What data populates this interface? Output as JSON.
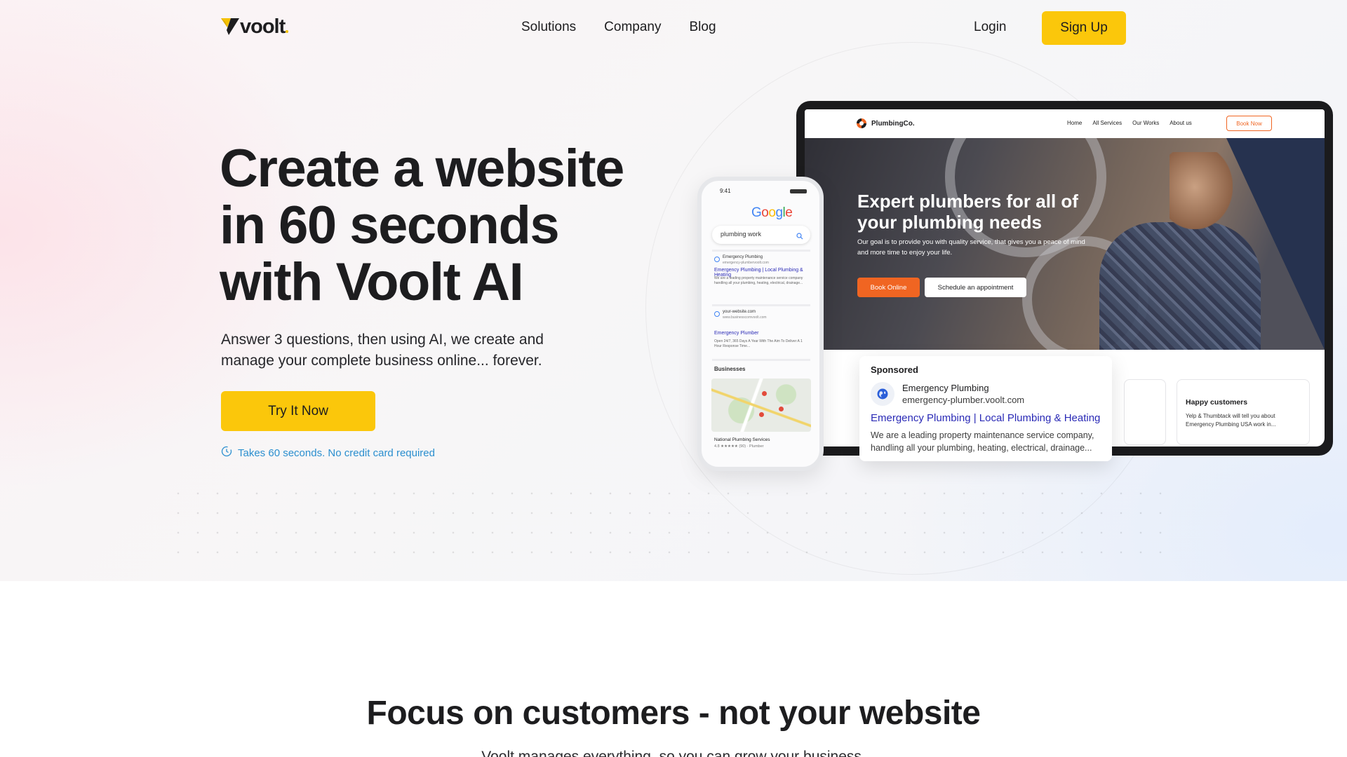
{
  "brand": {
    "name": "voolt",
    "accent": "#fbc70b"
  },
  "nav": {
    "links": [
      "Solutions",
      "Company",
      "Blog"
    ],
    "login": "Login",
    "signup": "Sign Up"
  },
  "hero": {
    "title_lines": [
      "Create a website",
      "in 60 seconds",
      "with Voolt AI"
    ],
    "subtitle": "Answer 3 questions, then using AI, we create and manage your complete business online... forever.",
    "cta": "Try It Now",
    "note": "Takes 60 seconds. No credit card required",
    "note_icon": "clock-icon"
  },
  "laptop_site": {
    "logo": "PlumbingCo.",
    "links": [
      "Home",
      "All Services",
      "Our Works",
      "About us"
    ],
    "book_now": "Book Now",
    "title": "Expert plumbers for all of your plumbing needs",
    "description": "Our goal is to provide you with quality service, that gives you a peace of mind and more time to enjoy your life.",
    "btn_primary": "Book Online",
    "btn_secondary": "Schedule an appointment",
    "primary_color": "#f06522",
    "card": {
      "title": "Happy customers",
      "text": "Yelp & Thumbtack will tell you about Emergency Plumbing USA work in..."
    }
  },
  "sponsored": {
    "label": "Sponsored",
    "name": "Emergency Plumbing",
    "url": "emergency-plumber.voolt.com",
    "link": "Emergency Plumbing | Local Plumbing & Heating",
    "description": "We are a leading property maintenance service company, handling all your plumbing, heating, electrical, drainage..."
  },
  "phone": {
    "time": "9:41",
    "google": "Google",
    "query": "plumbing work",
    "results": [
      {
        "name": "Emergency Plumbing",
        "url": "emergency-plumbervoolt.com",
        "link": "Emergency Plumbing | Local Plumbing & Heating",
        "desc": "We are a leading property maintenance service company handling all your plumbing, heating, electrical, drainage..."
      },
      {
        "name": "your-website.com",
        "url": "www.businesscomvoolt.com",
        "link": "Emergency Plumber",
        "desc": "Open 24/7, 365 Days A Year With The Aim To Deliver A 1 Hour Response Time..."
      }
    ],
    "businesses_label": "Businesses",
    "business_name": "National Plumbing Services",
    "business_rating": "4.8 ★★★★★ (90) · Plumber"
  },
  "section": {
    "title": "Focus on customers - not your website",
    "subtitle": "Voolt manages everything, so you can grow your business."
  }
}
